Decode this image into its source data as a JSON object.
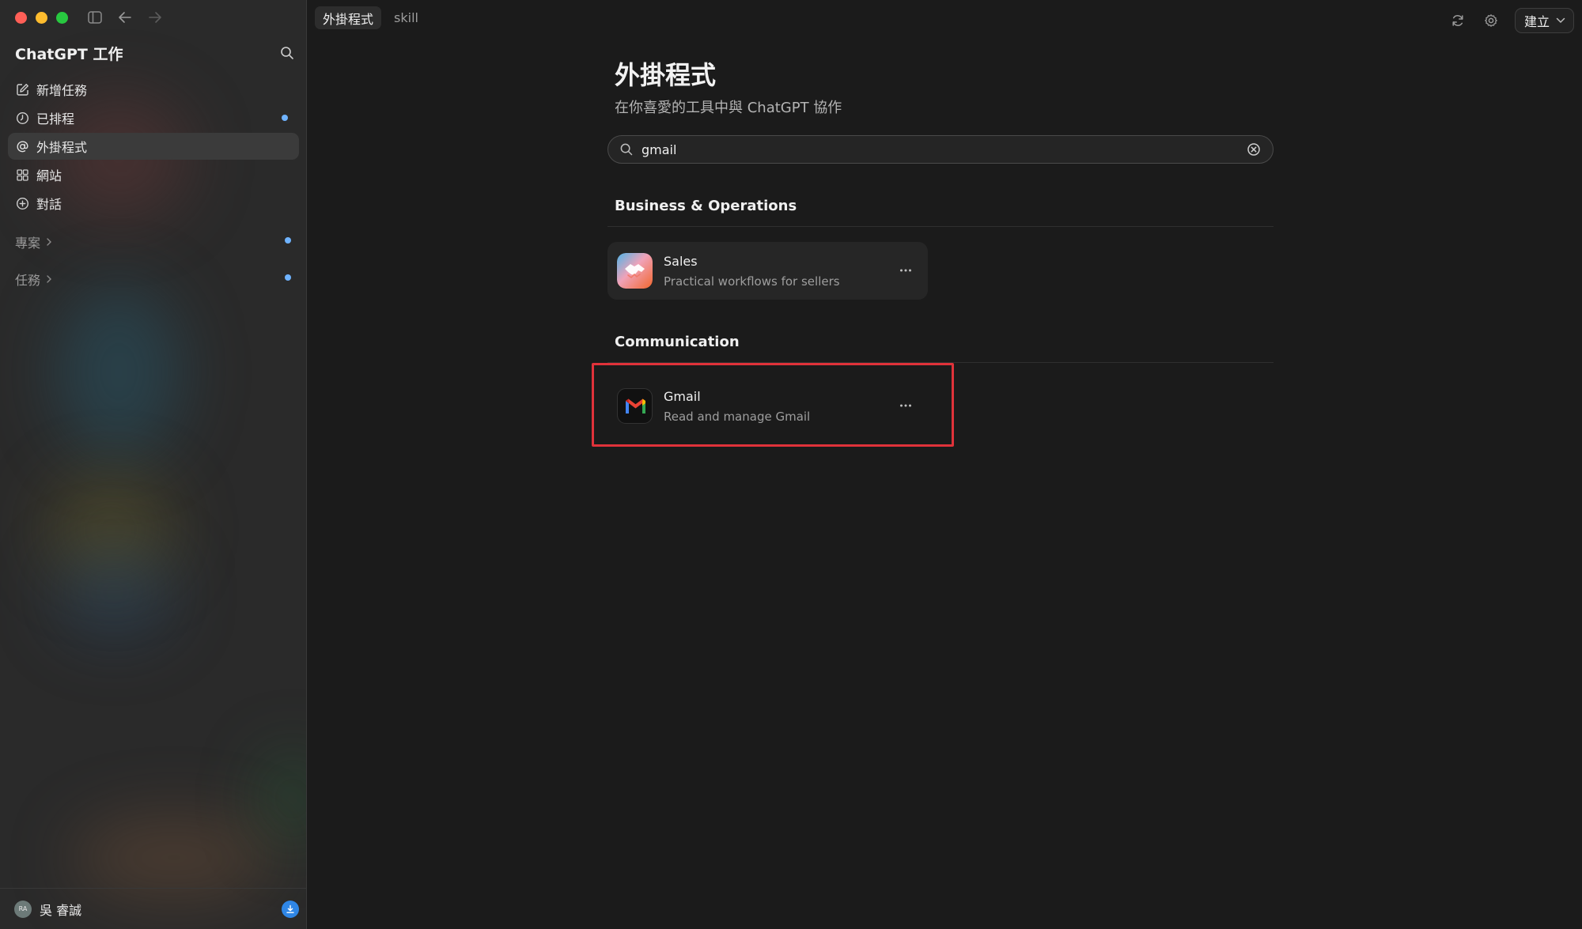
{
  "window": {
    "title": "ChatGPT 工作"
  },
  "sidebar": {
    "app_title": "ChatGPT 工作",
    "items": [
      {
        "label": "新增任務",
        "icon": "compose-icon",
        "dot": false
      },
      {
        "label": "已排程",
        "icon": "clock-icon",
        "dot": true
      },
      {
        "label": "外掛程式",
        "icon": "at-sign-icon",
        "dot": false,
        "active": true
      },
      {
        "label": "網站",
        "icon": "grid-icon",
        "dot": false
      },
      {
        "label": "對話",
        "icon": "plus-circle-icon",
        "dot": false
      }
    ],
    "sections": [
      {
        "label": "專案",
        "dot": true
      },
      {
        "label": "任務",
        "dot": true
      }
    ],
    "user": {
      "initials": "RA",
      "name": "吳 睿誠"
    }
  },
  "header": {
    "tabs": [
      {
        "label": "外掛程式",
        "active": true
      },
      {
        "label": "skill",
        "active": false
      }
    ],
    "create_label": "建立"
  },
  "main": {
    "title": "外掛程式",
    "subtitle": "在你喜愛的工具中與 ChatGPT 協作",
    "search": {
      "value": "gmail",
      "placeholder": ""
    },
    "categories": [
      {
        "title": "Business & Operations",
        "plugins": [
          {
            "name": "Sales",
            "description": "Practical workflows for sellers",
            "icon": "sales-handshake-icon"
          }
        ]
      },
      {
        "title": "Communication",
        "plugins": [
          {
            "name": "Gmail",
            "description": "Read and manage Gmail",
            "icon": "gmail-icon"
          }
        ]
      }
    ]
  },
  "colors": {
    "accent_dot": "#6fb3ff",
    "highlight": "#e0323a",
    "download": "#2f86e6"
  }
}
